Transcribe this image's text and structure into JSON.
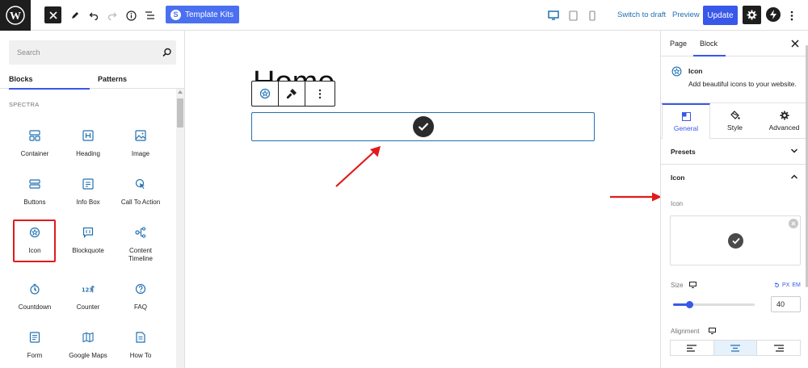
{
  "toolbar": {
    "template_kits_label": "Template Kits",
    "switch_to_draft_label": "Switch to draft",
    "preview_label": "Preview",
    "update_label": "Update"
  },
  "inserter": {
    "search_placeholder": "Search",
    "tabs": [
      "Blocks",
      "Patterns"
    ],
    "category": "SPECTRA",
    "blocks": [
      {
        "label": "Container",
        "icon": "container-icon"
      },
      {
        "label": "Heading",
        "icon": "heading-icon"
      },
      {
        "label": "Image",
        "icon": "image-icon"
      },
      {
        "label": "Buttons",
        "icon": "buttons-icon"
      },
      {
        "label": "Info Box",
        "icon": "info-box-icon"
      },
      {
        "label": "Call To Action",
        "icon": "call-to-action-icon"
      },
      {
        "label": "Icon",
        "icon": "icon-block-icon"
      },
      {
        "label": "Blockquote",
        "icon": "blockquote-icon"
      },
      {
        "label": "Content Timeline",
        "icon": "content-timeline-icon"
      },
      {
        "label": "Countdown",
        "icon": "countdown-icon"
      },
      {
        "label": "Counter",
        "icon": "counter-icon"
      },
      {
        "label": "FAQ",
        "icon": "faq-icon"
      },
      {
        "label": "Form",
        "icon": "form-icon"
      },
      {
        "label": "Google Maps",
        "icon": "google-maps-icon"
      },
      {
        "label": "How To",
        "icon": "how-to-icon"
      }
    ]
  },
  "canvas": {
    "page_heading": "Home"
  },
  "sidebar": {
    "tabs": [
      "Page",
      "Block"
    ],
    "block_title": "Icon",
    "block_description": "Add beautiful icons to your website.",
    "panel_tabs": [
      "General",
      "Style",
      "Advanced"
    ],
    "presets_label": "Presets",
    "icon_section_label": "Icon",
    "icon_field_label": "Icon",
    "size_label": "Size",
    "size_units": [
      "PX",
      "EM"
    ],
    "size_value": "40",
    "size_slider_fraction": 0.2,
    "alignment_label": "Alignment",
    "alignment_options": [
      "left",
      "center",
      "right"
    ],
    "alignment_selected": "center"
  },
  "colors": {
    "accent": "#3858e9",
    "annotation": "#e01b1b",
    "link": "#2271b1"
  }
}
